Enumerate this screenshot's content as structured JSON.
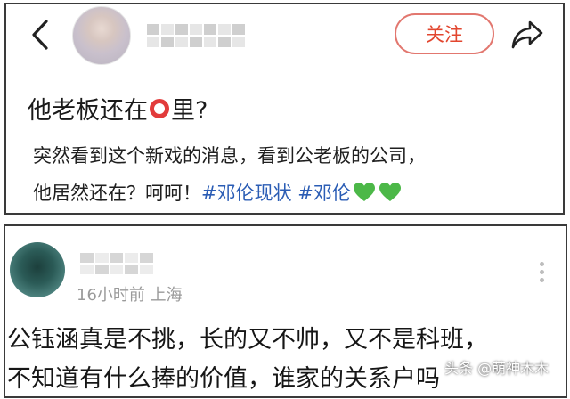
{
  "post": {
    "follow_label": "关注",
    "title_prefix": "他老板还在",
    "title_suffix": "里?",
    "body_line1": "突然看到这个新戏的消息，看到公老板的公司，",
    "body_line2_prefix": "他居然还在？呵呵！",
    "hashtags": [
      "#邓伦现状",
      "#邓伦"
    ]
  },
  "comment": {
    "meta": "16小时前 上海",
    "line1": "公钰涵真是不挑，长的又不帅，又不是科班，",
    "line2": "不知道有什么捧的价值，谁家的关系户吗"
  },
  "watermark": "头条 @萌神木木",
  "colors": {
    "follow_accent": "#e2462f",
    "hashtag": "#2b5db5",
    "heart": "#4cb848",
    "ring": "#e23b3b",
    "meta_text": "#9a9a9a"
  },
  "icons": [
    "back-icon",
    "share-icon",
    "green-heart-icon",
    "red-ring-icon",
    "more-dots-icon"
  ]
}
